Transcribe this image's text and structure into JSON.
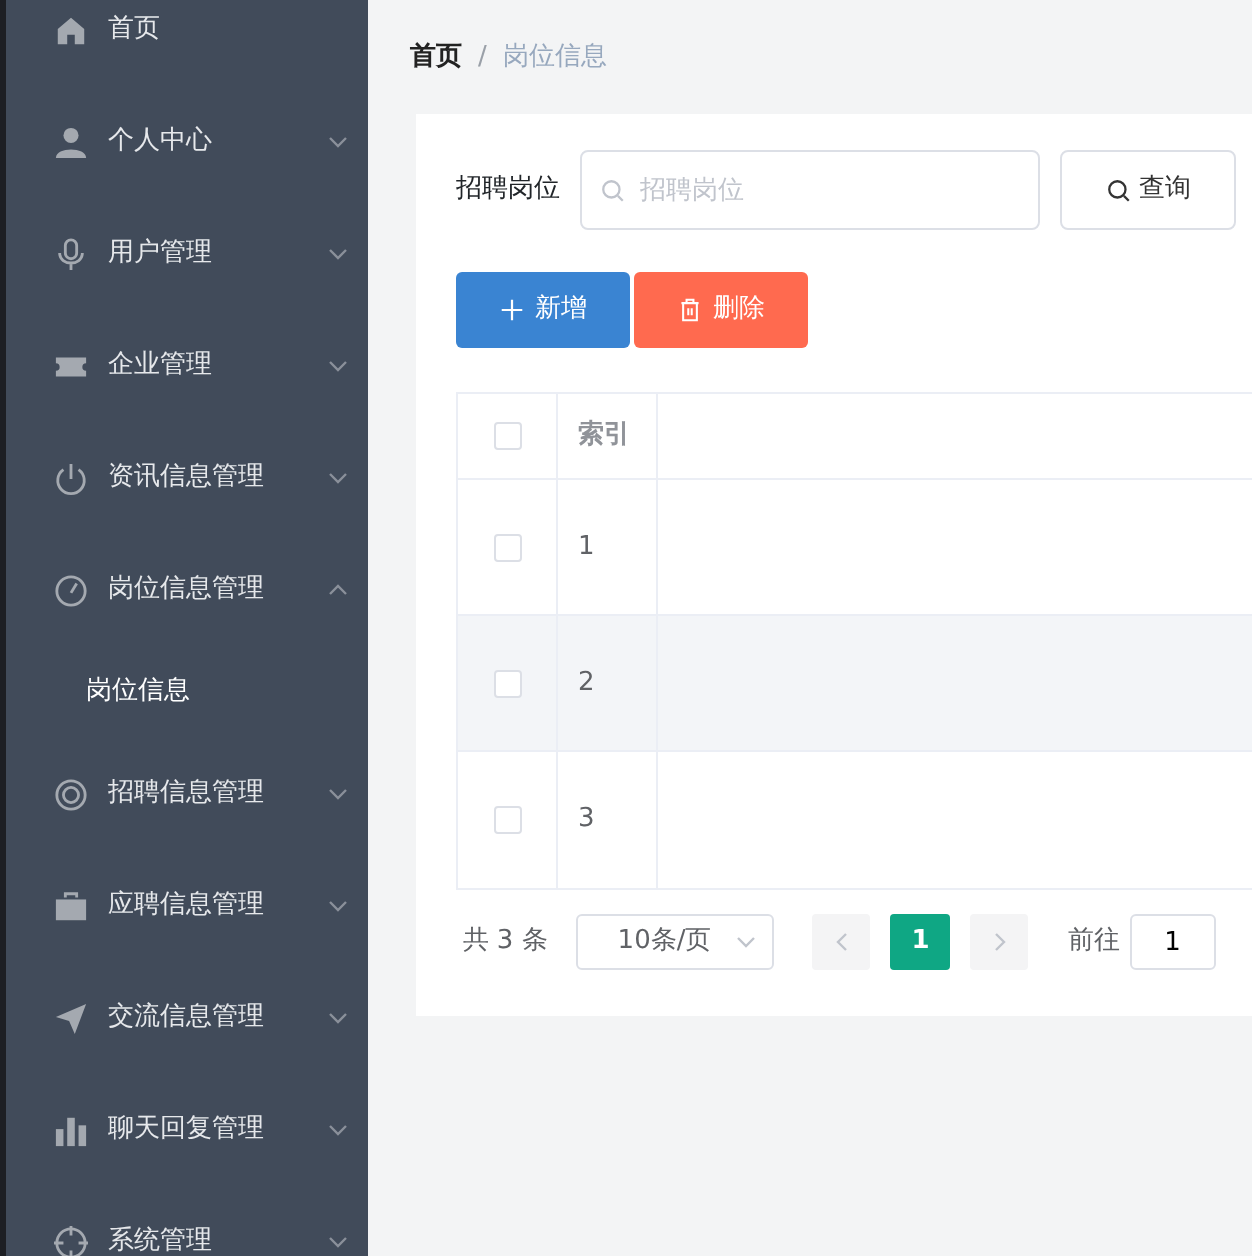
{
  "sidebar": {
    "items": [
      {
        "label": "首页",
        "kind": "link"
      },
      {
        "label": "个人中心",
        "kind": "submenu",
        "expanded": false
      },
      {
        "label": "用户管理",
        "kind": "submenu",
        "expanded": false
      },
      {
        "label": "企业管理",
        "kind": "submenu",
        "expanded": false
      },
      {
        "label": "资讯信息管理",
        "kind": "submenu",
        "expanded": false
      },
      {
        "label": "岗位信息管理",
        "kind": "submenu",
        "expanded": true,
        "children": [
          {
            "label": "岗位信息"
          }
        ]
      },
      {
        "label": "招聘信息管理",
        "kind": "submenu",
        "expanded": false
      },
      {
        "label": "应聘信息管理",
        "kind": "submenu",
        "expanded": false
      },
      {
        "label": "交流信息管理",
        "kind": "submenu",
        "expanded": false
      },
      {
        "label": "聊天回复管理",
        "kind": "submenu",
        "expanded": false
      },
      {
        "label": "系统管理",
        "kind": "submenu",
        "expanded": false
      }
    ]
  },
  "breadcrumb_separator": "/",
  "breadcrumb": [
    {
      "label": "首页"
    },
    {
      "label": "岗位信息"
    }
  ],
  "search": {
    "label": "招聘岗位",
    "placeholder": "招聘岗位",
    "button": "查询"
  },
  "actions": [
    {
      "label": "新增",
      "kind": "add"
    },
    {
      "label": "删除",
      "kind": "delete"
    }
  ],
  "table": {
    "header_checked": false,
    "columns": [
      "索引"
    ],
    "rows": [
      {
        "index": "1",
        "checked": false
      },
      {
        "index": "2",
        "checked": false
      },
      {
        "index": "3",
        "checked": false
      }
    ]
  },
  "pagination": {
    "total": "共 3 条",
    "page_size": "10条/页",
    "pages": [
      {
        "label": "1",
        "selected": true
      }
    ],
    "goto_label": "前往",
    "goto_value": "1"
  }
}
